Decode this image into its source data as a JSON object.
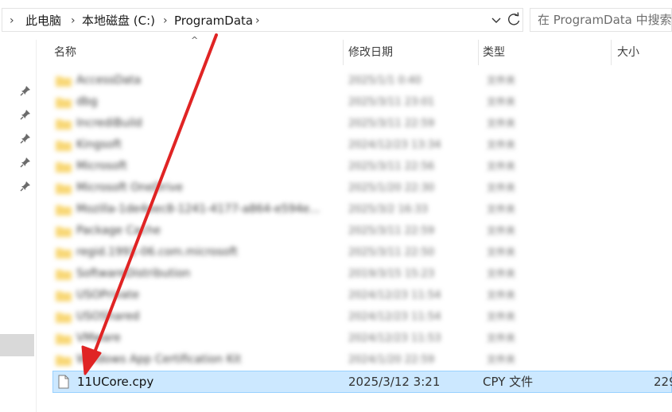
{
  "breadcrumb": {
    "items": [
      "此电脑",
      "本地磁盘 (C:)",
      "ProgramData"
    ]
  },
  "address_dropdown_icon": "chevron-down",
  "refresh_icon": "refresh",
  "search": {
    "placeholder": "在 ProgramData 中搜索"
  },
  "columns": {
    "name": "名称",
    "date": "修改日期",
    "type": "类型",
    "size": "大小"
  },
  "blurred_rows": [
    {
      "name": "AccessData",
      "date": "2025/1/1 0:40",
      "type": "文件夹"
    },
    {
      "name": "dbg",
      "date": "2025/3/11 23:01",
      "type": "文件夹"
    },
    {
      "name": "IncrediBuild",
      "date": "2025/3/11 22:59",
      "type": "文件夹"
    },
    {
      "name": "Kingsoft",
      "date": "2024/12/23 13:34",
      "type": "文件夹"
    },
    {
      "name": "Microsoft",
      "date": "2025/3/11 22:56",
      "type": "文件夹"
    },
    {
      "name": "Microsoft OneDrive",
      "date": "2025/1/20 22:30",
      "type": "文件夹"
    },
    {
      "name": "Mozilla-1de4eec8-1241-4177-a864-e594e...",
      "date": "2025/3/2 16:33",
      "type": "文件夹"
    },
    {
      "name": "Package Cache",
      "date": "2025/3/11 22:59",
      "type": "文件夹"
    },
    {
      "name": "regid.1991-06.com.microsoft",
      "date": "2025/3/11 22:50",
      "type": "文件夹"
    },
    {
      "name": "SoftwareDistribution",
      "date": "2019/3/15 15:23",
      "type": "文件夹"
    },
    {
      "name": "USOPrivate",
      "date": "2024/12/23 11:54",
      "type": "文件夹"
    },
    {
      "name": "USOShared",
      "date": "2024/12/23 11:54",
      "type": "文件夹"
    },
    {
      "name": "VMware",
      "date": "2024/12/23 11:53",
      "type": "文件夹"
    },
    {
      "name": "Windows App Certification Kit",
      "date": "2024/1/20 22:59",
      "type": "文件夹"
    }
  ],
  "selected_file": {
    "name": "11UCore.cpy",
    "date": "2025/3/12 3:21",
    "type": "CPY 文件",
    "size": "229"
  },
  "colors": {
    "selection_bg": "#cce8ff",
    "selection_border": "#99d1ff",
    "folder_yellow": "#f8d775",
    "annotation_arrow": "#e02424"
  }
}
